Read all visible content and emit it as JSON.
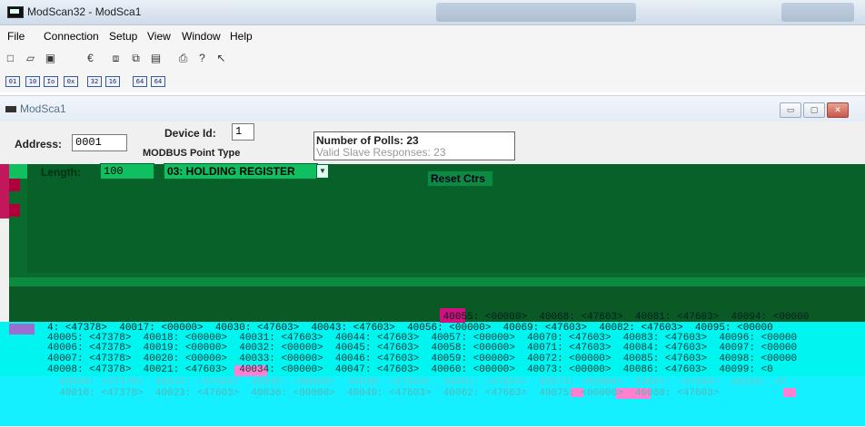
{
  "window": {
    "title": "ModScan32 - ModSca1"
  },
  "menu": [
    {
      "label": "File"
    },
    {
      "label": "Connection"
    },
    {
      "label": "Setup"
    },
    {
      "label": "View"
    },
    {
      "label": "Window"
    },
    {
      "label": "Help"
    }
  ],
  "toolbar1_icons": [
    "new-icon",
    "open-icon",
    "save-icon",
    "euro-icon",
    "connect-icon",
    "disconnect-icon",
    "monitor-icon",
    "print-icon",
    "help-icon",
    "context-help-icon"
  ],
  "toolbar2_icons": [
    "coil-icon",
    "input-status-icon",
    "holding-icon",
    "input-register-icon",
    "read-icon",
    "write-icon",
    "analog-icon",
    "analog-write-icon"
  ],
  "child": {
    "title": "ModSca1",
    "device_id_label": "Device Id:",
    "device_id": "1",
    "address_label": "Address:",
    "address": "0001",
    "modbus_type_label": "MODBUS Point Type",
    "length_label": "Length:",
    "length": "100",
    "point_type": "03: HOLDING REGISTER",
    "polls_label": "Number of Polls: 23",
    "valid_label": "Valid Slave Responses: 23",
    "reset_label": "Reset Ctrs"
  },
  "colors": {
    "green": "#0a6b2e",
    "cyan": "#00f5f0",
    "magenta": "#d8109a"
  },
  "data_rows": [
    "                                                                  40055: <00000>  40068: <47603>  40081: <47603>  40094: <00000",
    "4: <47378>  40017: <00000>  40030: <47603>  40043: <47603>  40056: <00000>  40069: <47603>  40082: <47603>  40095: <00000",
    "40005: <47378>  40018: <00000>  40031: <47603>  40044: <47603>  40057: <00000>  40070: <47603>  40083: <47603>  40096: <00000",
    "40006: <47378>  40019: <00000>  40032: <00000>  40045: <47603>  40058: <00000>  40071: <47603>  40084: <47603>  40097: <00000",
    "40007: <47378>  40020: <00000>  40033: <00000>  40046: <47603>  40059: <00000>  40072: <00000>  40085: <47603>  40098: <00000",
    "40008: <47378>  40021: <47603>  40034: <00000>  40047: <47603>  40060: <00000>  40073: <00000>  40086: <47603>  40099: <0",
    "  40009: <47378>  40022: <47603>  40035: <00000>  40048: <47603>  40061: <47603>  40074: <00000>  40087: <47603>  40100: <0",
    "  40010: <47378>  40023: <47603>  40036: <00000>  40049: <47603>  40062: <47603>  40075: <00000>  40088: <47603>"
  ]
}
